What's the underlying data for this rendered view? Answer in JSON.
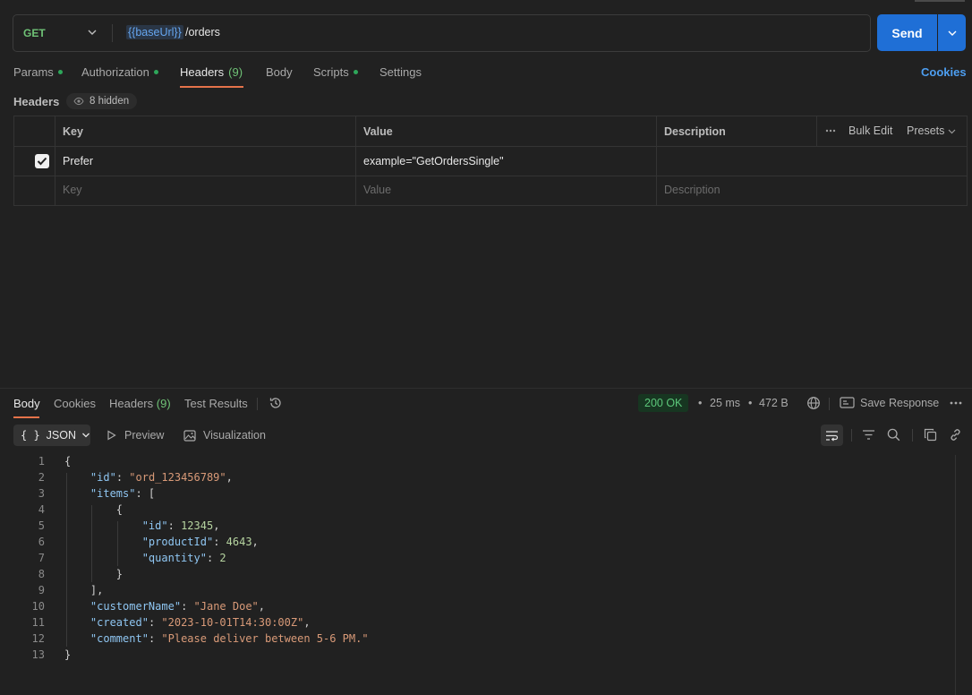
{
  "request": {
    "method": "GET",
    "url_variable": "{{baseUrl}}",
    "url_path": " /orders",
    "send_label": "Send"
  },
  "tabs": [
    {
      "label": "Params",
      "dot": true
    },
    {
      "label": "Authorization",
      "dot": true
    },
    {
      "label": "Headers",
      "count": "(9)",
      "active": true
    },
    {
      "label": "Body"
    },
    {
      "label": "Scripts",
      "dot": true
    },
    {
      "label": "Settings"
    }
  ],
  "cookies_label": "Cookies",
  "headers_section": {
    "label": "Headers",
    "hidden_label": "8 hidden",
    "columns": [
      "Key",
      "Value",
      "Description"
    ],
    "bulk_edit": "Bulk Edit",
    "presets": "Presets",
    "rows": [
      {
        "checked": true,
        "key": "Prefer",
        "value": "example=\"GetOrdersSingle\"",
        "description": ""
      }
    ],
    "placeholder": {
      "key": "Key",
      "value": "Value",
      "description": "Description"
    }
  },
  "response": {
    "tabs": [
      {
        "label": "Body",
        "active": true
      },
      {
        "label": "Cookies"
      },
      {
        "label": "Headers",
        "count": "(9)"
      },
      {
        "label": "Test Results"
      }
    ],
    "status": "200 OK",
    "time": "25 ms",
    "size": "472 B",
    "save_label": "Save Response",
    "format": "JSON",
    "preview_label": "Preview",
    "visualization_label": "Visualization",
    "code_lines": [
      "{",
      "    \"id\": \"ord_123456789\",",
      "    \"items\": [",
      "        {",
      "            \"id\": 12345,",
      "            \"productId\": 4643,",
      "            \"quantity\": 2",
      "        }",
      "    ],",
      "    \"customerName\": \"Jane Doe\",",
      "    \"created\": \"2023-10-01T14:30:00Z\",",
      "    \"comment\": \"Please deliver between 5-6 PM.\"",
      "}"
    ]
  },
  "colors": {
    "accent": "#1f6fd6",
    "active_underline": "#e5734a",
    "success": "#5cc77a",
    "background": "#212121"
  }
}
